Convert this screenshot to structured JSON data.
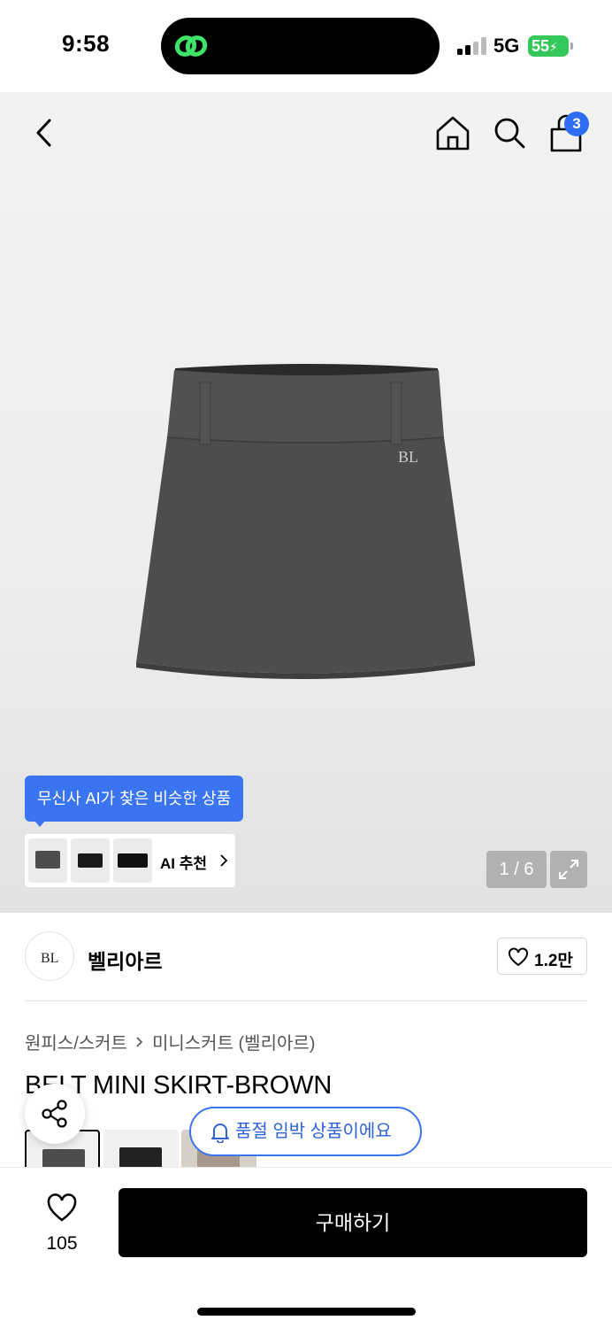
{
  "status_bar": {
    "time": "9:58",
    "network": "5G",
    "battery": "55"
  },
  "header": {
    "cart_count": "3"
  },
  "gallery": {
    "ai_tooltip": "무신사 AI가 찾은 비슷한 상품",
    "ai_label": "AI 추천",
    "page_counter": "1 / 6"
  },
  "brand": {
    "name": "벨리아르",
    "like_count": "1.2만"
  },
  "product": {
    "breadcrumb": [
      "원피스/스커트",
      "미니스커트 (벨리아르)"
    ],
    "title": "BELT MINI SKIRT-BROWN"
  },
  "notice": {
    "soldout_label": "품절 임박 상품이에요"
  },
  "bottom_bar": {
    "wish_count": "105",
    "buy_label": "구매하기"
  },
  "colors": {
    "accent": "#3b74f0",
    "battery": "#34c759",
    "badge": "#2d6cf5",
    "skirt": "#4e4d4b"
  }
}
